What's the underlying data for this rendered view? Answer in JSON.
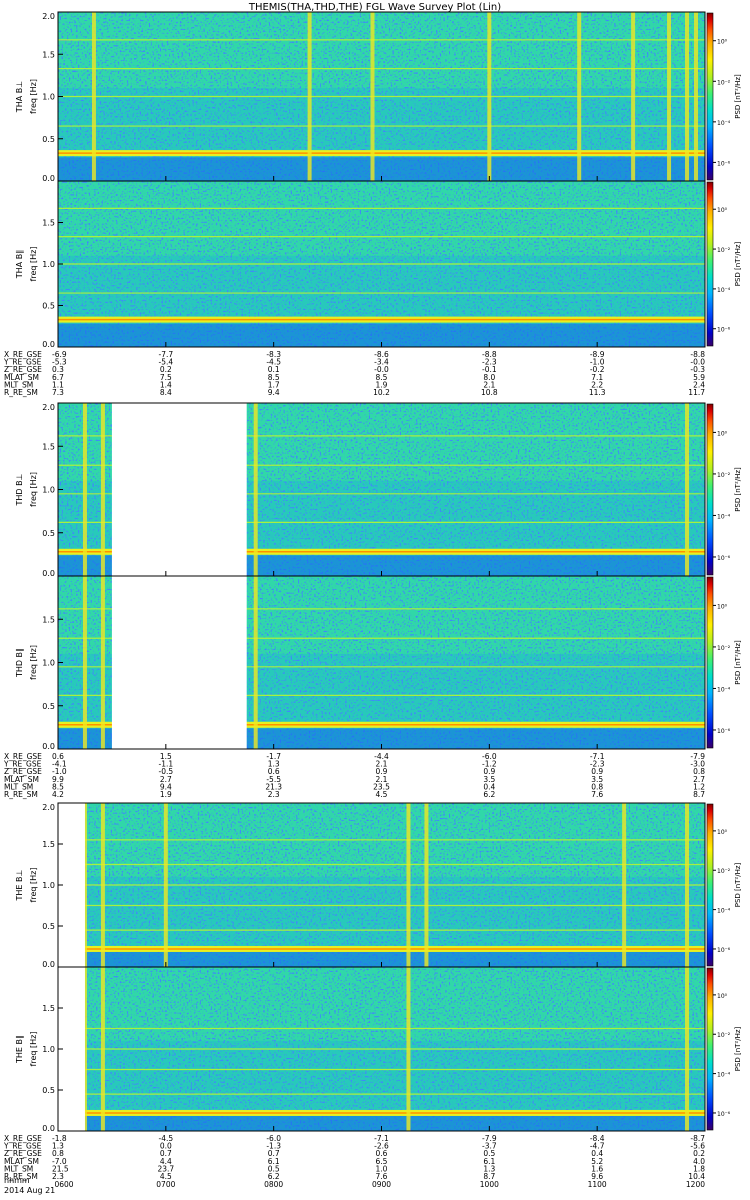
{
  "title": "THEMIS(THA,THD,THE) FGL Wave Survey Plot (Lin)",
  "colorbar": {
    "label": "PSD [nT²/Hz]",
    "tick_labels": [
      "10⁰",
      "10⁻²",
      "10⁻⁴",
      "10⁻⁶"
    ],
    "scale": "log",
    "colors": [
      "#3a0066",
      "#0000c8",
      "#0050ff",
      "#00b4ff",
      "#00e0c8",
      "#40f070",
      "#b4f020",
      "#fff000",
      "#ffb000",
      "#ff5000",
      "#d80000",
      "#800000"
    ]
  },
  "x_axis": {
    "tick_labels": [
      "0600",
      "0700",
      "0800",
      "0900",
      "1000",
      "1100",
      "1200"
    ],
    "row_label": "hhmm",
    "date_label": "2014 Aug 21"
  },
  "y_axis": {
    "tick_labels": [
      "0.0",
      "0.5",
      "1.0",
      "1.5",
      "2.0"
    ],
    "unit_label": "freq [Hz]"
  },
  "panels": {
    "tha_bl": {
      "label": "THA B⊥"
    },
    "tha_bpar": {
      "label": "THA B∥"
    },
    "thd_bl": {
      "label": "THD B⊥"
    },
    "thd_bpar": {
      "label": "THD B∥"
    },
    "the_bl": {
      "label": "THE B⊥"
    },
    "the_bpar": {
      "label": "THE B∥"
    }
  },
  "orbit_tables": {
    "tha": {
      "rows": [
        {
          "name": "X_RE_GSE",
          "values": [
            "-6.9",
            "-7.7",
            "-8.3",
            "-8.6",
            "-8.8",
            "-8.9",
            "-8.8"
          ]
        },
        {
          "name": "Y_RE_GSE",
          "values": [
            "-5.3",
            "-5.4",
            "-4.5",
            "-3.4",
            "-2.3",
            "-1.0",
            "-0.0"
          ]
        },
        {
          "name": "Z_RE_GSE",
          "values": [
            "0.3",
            "0.2",
            "0.1",
            "-0.0",
            "-0.1",
            "-0.2",
            "-0.3"
          ]
        },
        {
          "name": "MLAT_SM",
          "values": [
            "6.7",
            "7.5",
            "8.5",
            "8.5",
            "8.0",
            "7.1",
            "5.9"
          ]
        },
        {
          "name": "MLT_SM",
          "values": [
            "1.1",
            "1.4",
            "1.7",
            "1.9",
            "2.1",
            "2.2",
            "2.4"
          ]
        },
        {
          "name": "R_RE_SM",
          "values": [
            "7.3",
            "8.4",
            "9.4",
            "10.2",
            "10.8",
            "11.3",
            "11.7"
          ]
        }
      ]
    },
    "thd": {
      "rows": [
        {
          "name": "X_RE_GSE",
          "values": [
            "0.6",
            "1.5",
            "-1.7",
            "-4.4",
            "-6.0",
            "-7.1",
            "-7.9"
          ]
        },
        {
          "name": "Y_RE_GSE",
          "values": [
            "-4.1",
            "-1.1",
            "1.3",
            "2.1",
            "-1.2",
            "-2.3",
            "-3.0"
          ]
        },
        {
          "name": "Z_RE_GSE",
          "values": [
            "-1.0",
            "-0.5",
            "0.6",
            "0.9",
            "0.9",
            "0.9",
            "0.8"
          ]
        },
        {
          "name": "MLAT_SM",
          "values": [
            "9.9",
            "2.7",
            "-5.5",
            "2.1",
            "3.5",
            "3.5",
            "2.7"
          ]
        },
        {
          "name": "MLT_SM",
          "values": [
            "8.5",
            "9.4",
            "21.3",
            "23.5",
            "0.4",
            "0.8",
            "1.2"
          ]
        },
        {
          "name": "R_RE_SM",
          "values": [
            "4.2",
            "1.9",
            "2.3",
            "4.5",
            "6.2",
            "7.6",
            "8.7"
          ]
        }
      ]
    },
    "the": {
      "rows": [
        {
          "name": "X_RE_GSE",
          "values": [
            "-1.8",
            "-4.5",
            "-6.0",
            "-7.1",
            "-7.9",
            "-8.4",
            "-8.7"
          ]
        },
        {
          "name": "Y_RE_GSE",
          "values": [
            "1.3",
            "0.0",
            "-1.3",
            "-2.6",
            "-3.7",
            "-4.7",
            "-5.6"
          ]
        },
        {
          "name": "Z_RE_GSE",
          "values": [
            "0.8",
            "0.7",
            "0.7",
            "0.6",
            "0.5",
            "0.4",
            "0.2"
          ]
        },
        {
          "name": "MLAT_SM",
          "values": [
            "-7.0",
            "4.4",
            "6.1",
            "6.5",
            "6.1",
            "5.2",
            "4.0"
          ]
        },
        {
          "name": "MLT_SM",
          "values": [
            "21.5",
            "23.7",
            "0.5",
            "1.0",
            "1.3",
            "1.6",
            "1.8"
          ]
        },
        {
          "name": "R_RE_SM",
          "values": [
            "2.3",
            "4.5",
            "6.2",
            "7.6",
            "8.7",
            "9.6",
            "10.4"
          ]
        }
      ]
    }
  },
  "chart_data": {
    "type": "heatmap",
    "x_range": [
      "0600",
      "1200"
    ],
    "y_range": [
      0,
      2
    ],
    "panels": [
      {
        "id": "tha_bl",
        "data_gaps": [],
        "bright_times": [
          "0620",
          "0820",
          "0855",
          "1000",
          "1050",
          "1120",
          "1140",
          "1150",
          "1155"
        ],
        "harmonic_lines_hz": [
          0.33,
          0.65,
          1.0,
          1.33,
          1.67
        ],
        "bands_hz": [
          0.33
        ]
      },
      {
        "id": "tha_bpar",
        "data_gaps": [],
        "bright_times": [],
        "harmonic_lines_hz": [
          0.65,
          1.0,
          1.33,
          1.67
        ],
        "bands_hz": [
          0.33
        ]
      },
      {
        "id": "thd_bl",
        "data_gaps": [
          [
            "0630",
            "0745"
          ]
        ],
        "bright_times": [
          "0615",
          "0625",
          "0750",
          "1150"
        ],
        "harmonic_lines_hz": [
          0.62,
          0.95,
          1.28,
          1.62
        ],
        "bands_hz": [
          0.28
        ]
      },
      {
        "id": "thd_bpar",
        "data_gaps": [
          [
            "0630",
            "0745"
          ]
        ],
        "bright_times": [
          "0615",
          "0625",
          "0750"
        ],
        "harmonic_lines_hz": [
          0.62,
          0.95,
          1.28,
          1.62
        ],
        "bands_hz": [
          0.28
        ]
      },
      {
        "id": "the_bl",
        "data_gaps": [
          [
            "0600",
            "0615"
          ]
        ],
        "bright_times": [
          "0615",
          "0625",
          "0700",
          "0915",
          "0925",
          "1115",
          "1150"
        ],
        "harmonic_lines_hz": [
          0.45,
          0.75,
          1.0,
          1.25,
          1.55
        ],
        "bands_hz": [
          0.22
        ]
      },
      {
        "id": "the_bpar",
        "data_gaps": [
          [
            "0600",
            "0615"
          ]
        ],
        "bright_times": [
          "0615",
          "0625",
          "0915",
          "1150"
        ],
        "harmonic_lines_hz": [
          0.45,
          0.75,
          1.0,
          1.25
        ],
        "bands_hz": [
          0.22
        ]
      }
    ]
  }
}
